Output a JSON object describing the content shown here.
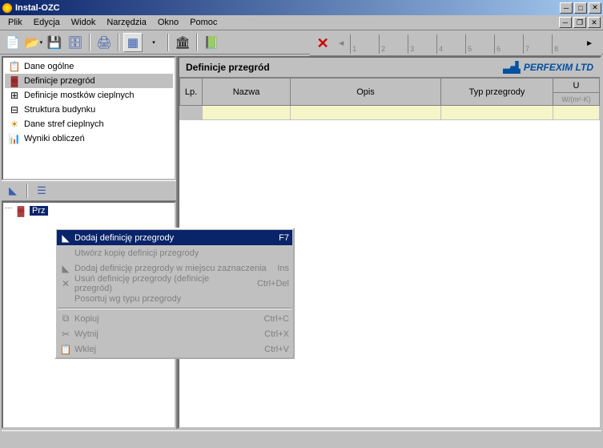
{
  "window": {
    "title": "Instal-OZC"
  },
  "menu": {
    "items": [
      "Plik",
      "Edycja",
      "Widok",
      "Narzędzia",
      "Okno",
      "Pomoc"
    ]
  },
  "tab_strip": {
    "numbers": [
      "1",
      "2",
      "3",
      "4",
      "5",
      "6",
      "7",
      "8"
    ]
  },
  "sidebar": {
    "top_items": [
      {
        "label": "Dane ogólne"
      },
      {
        "label": "Definicje przegród"
      },
      {
        "label": "Definicje mostków cieplnych"
      },
      {
        "label": "Struktura budynku"
      },
      {
        "label": "Dane stref cieplnych"
      },
      {
        "label": "Wyniki obliczeń"
      }
    ],
    "bottom_node": "Prz"
  },
  "content": {
    "title": "Definicje przegród",
    "brand": "PERFEXIM LTD",
    "columns": {
      "lp": "Lp.",
      "nazwa": "Nazwa",
      "opis": "Opis",
      "typ": "Typ przegrody",
      "u": "U",
      "u_unit": "W/(m²·K)"
    }
  },
  "context_menu": {
    "items": [
      {
        "label": "Dodaj definicję przegrody",
        "shortcut": "F7",
        "highlight": true,
        "icon": "add"
      },
      {
        "label": "Utwórz kopię definicji przegrody",
        "disabled": true
      },
      {
        "label": "Dodaj definicję przegrody w miejscu zaznaczenia",
        "shortcut": "Ins",
        "disabled": true,
        "icon": "insert"
      },
      {
        "label": "Usuń definicję przegrody (definicje przegród)",
        "shortcut": "Ctrl+Del",
        "disabled": true,
        "icon": "delete"
      },
      {
        "label": "Posortuj wg typu przegrody",
        "disabled": true
      },
      {
        "sep": true
      },
      {
        "label": "Kopiuj",
        "shortcut": "Ctrl+C",
        "disabled": true,
        "icon": "copy"
      },
      {
        "label": "Wytnij",
        "shortcut": "Ctrl+X",
        "disabled": true,
        "icon": "cut"
      },
      {
        "label": "Wklej",
        "shortcut": "Ctrl+V",
        "disabled": true,
        "icon": "paste"
      }
    ]
  }
}
